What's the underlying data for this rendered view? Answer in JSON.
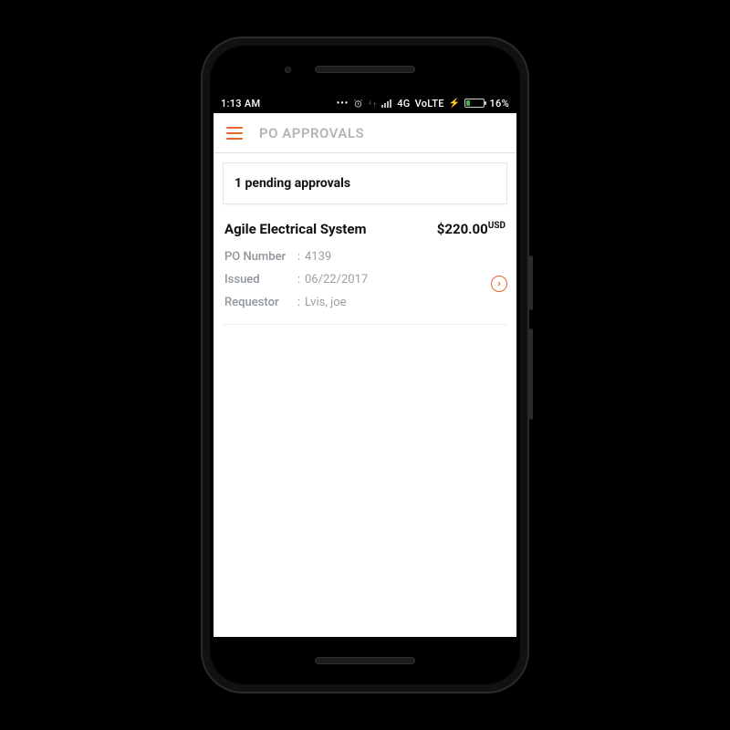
{
  "statusbar": {
    "time": "1:13 AM",
    "network_label": "4G",
    "volte_label": "VoLTE",
    "charge_icon": "⚡",
    "battery_pct": "16%"
  },
  "appbar": {
    "title": "PO APPROVALS"
  },
  "summary": {
    "pending_text": "1 pending approvals"
  },
  "po": {
    "title": "Agile Electrical System",
    "amount": "$220.00",
    "currency": "USD",
    "fields": {
      "po_number": {
        "label": "PO Number",
        "value": "4139"
      },
      "issued": {
        "label": "Issued",
        "value": "06/22/2017"
      },
      "requestor": {
        "label": "Requestor",
        "value": "Lvis, joe"
      }
    }
  }
}
